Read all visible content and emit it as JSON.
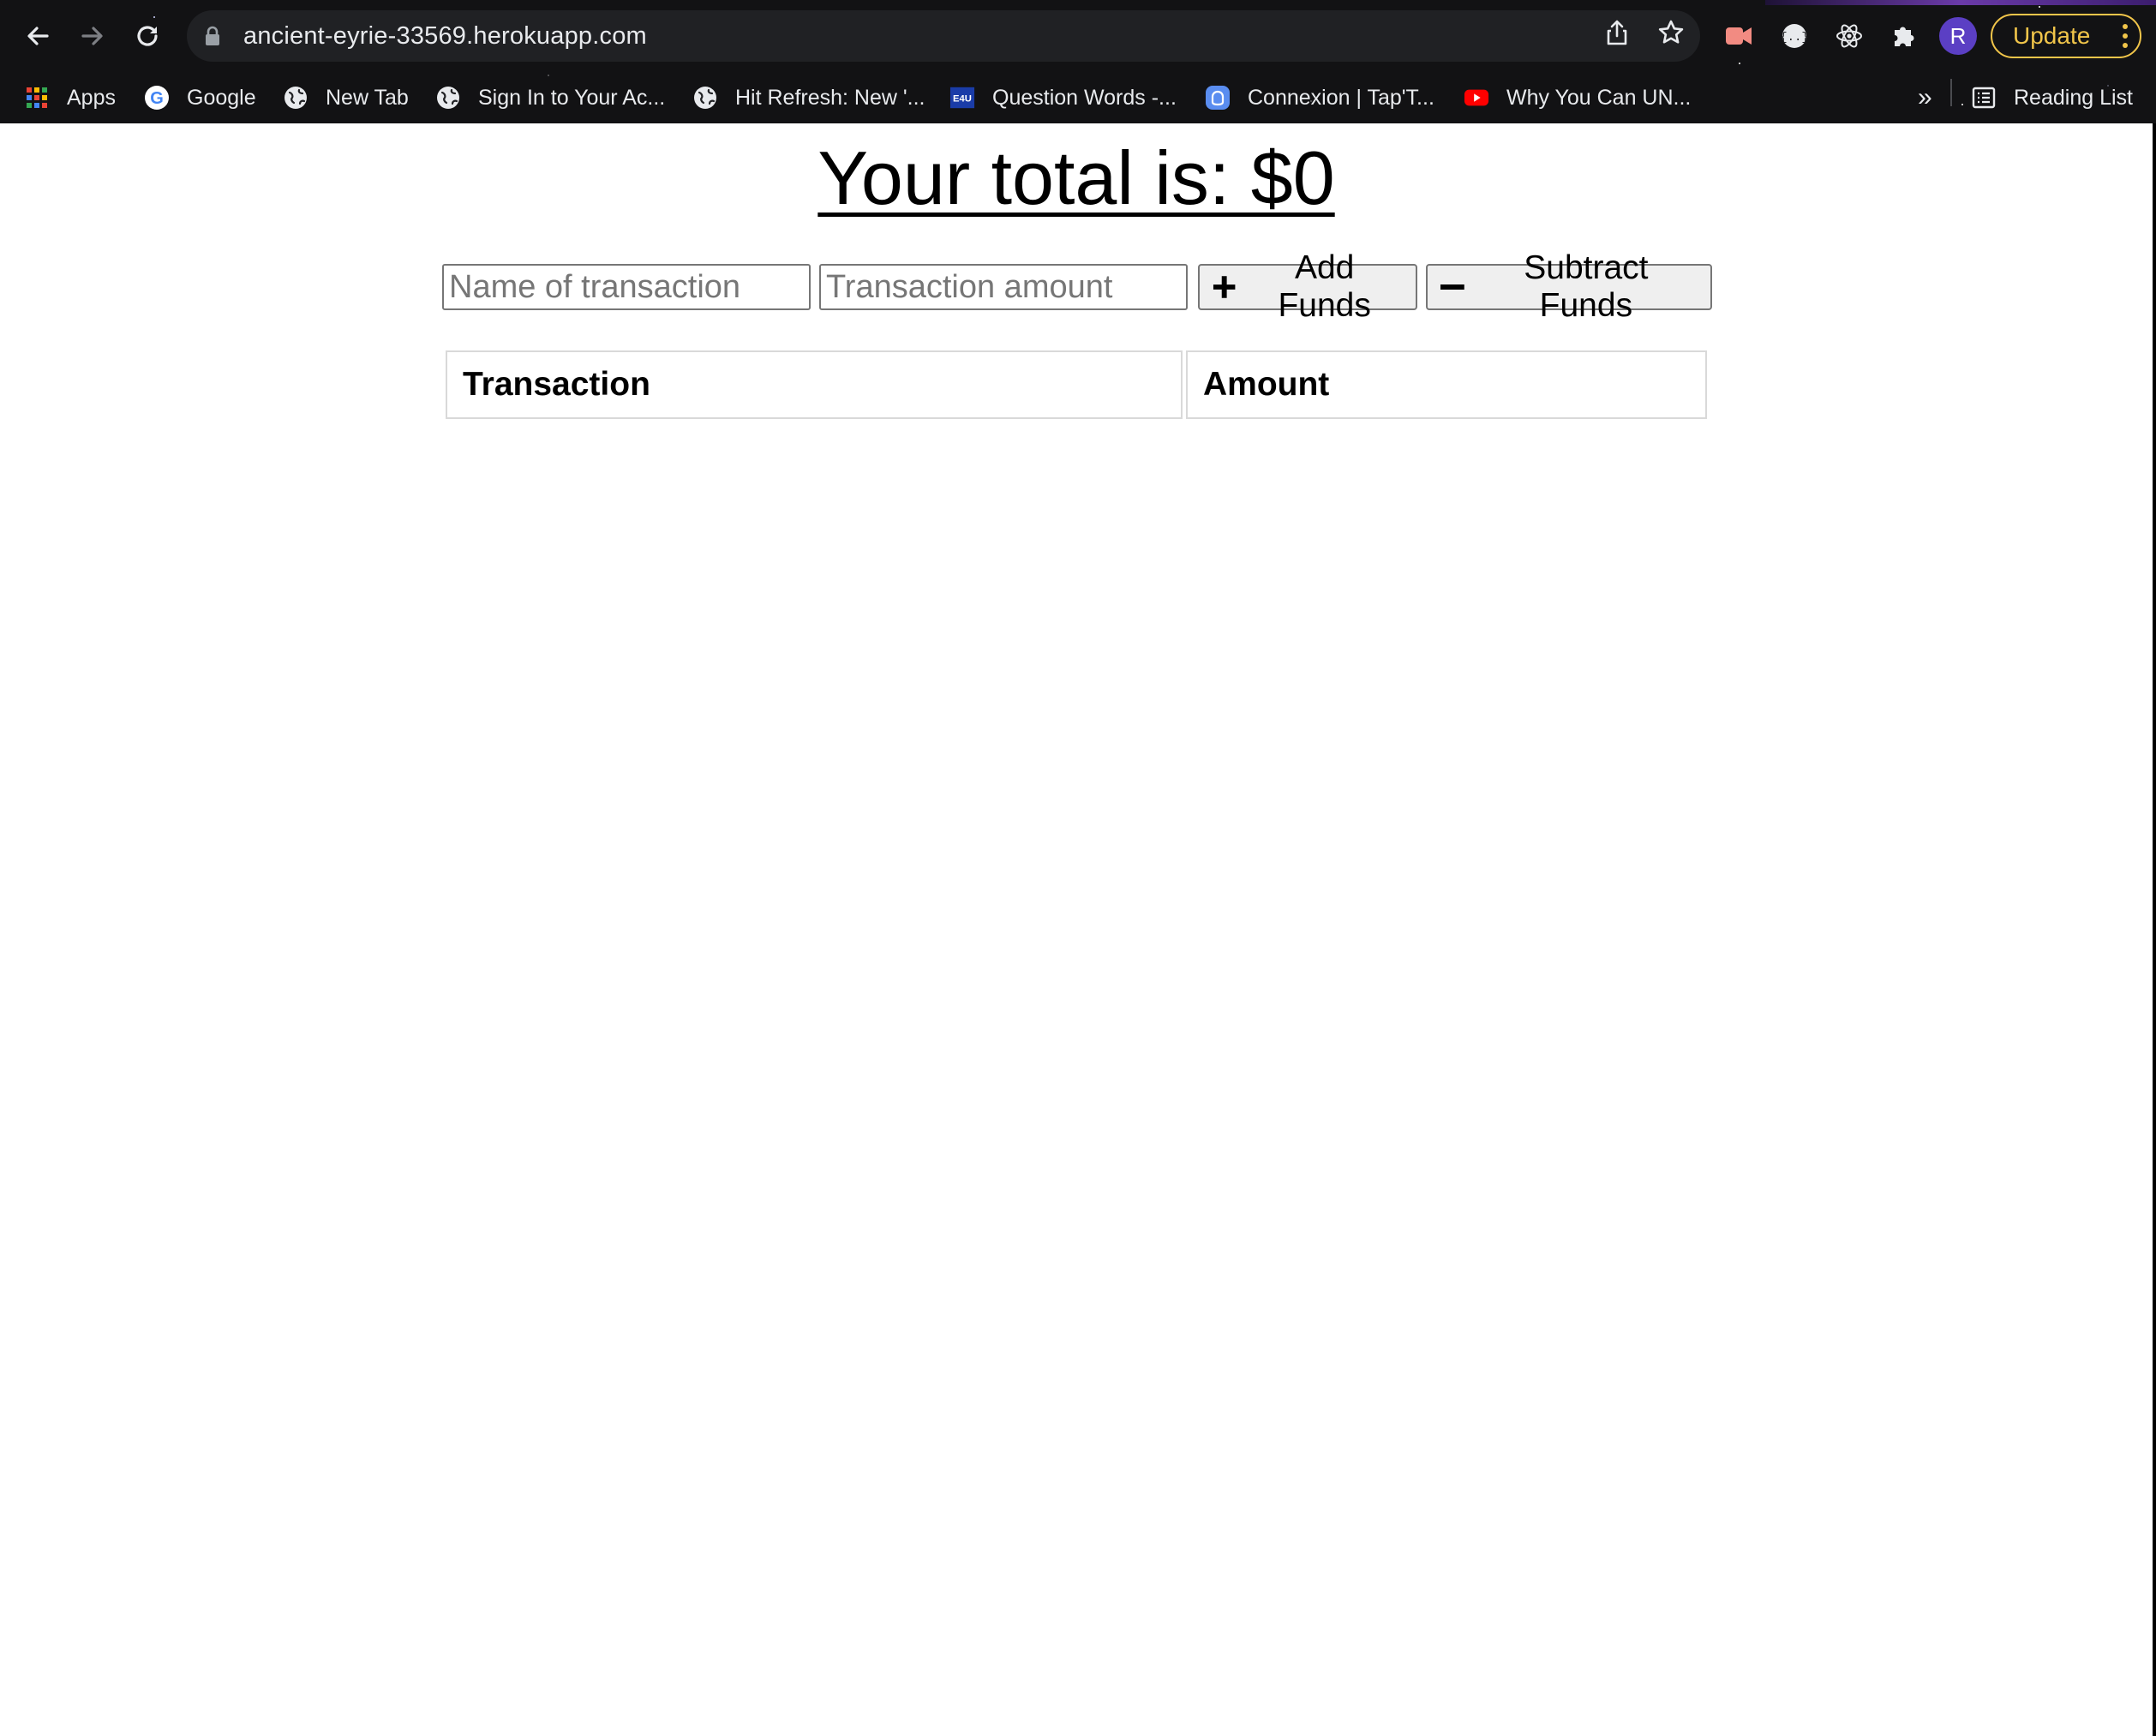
{
  "browser": {
    "url": "ancient-eyrie-33569.herokuapp.com",
    "update_label": "Update",
    "avatar_initial": "R",
    "bookmarks": [
      {
        "label": "Apps",
        "icon": "apps-grid-icon"
      },
      {
        "label": "Google",
        "icon": "google-icon"
      },
      {
        "label": "New Tab",
        "icon": "globe-icon"
      },
      {
        "label": "Sign In to Your Ac...",
        "icon": "globe-icon"
      },
      {
        "label": "Hit Refresh: New '...",
        "icon": "globe-icon"
      },
      {
        "label": "Question Words -...",
        "icon": "e4u-icon"
      },
      {
        "label": "Connexion | Tap'T...",
        "icon": "tap-icon"
      },
      {
        "label": "Why You Can UN...",
        "icon": "youtube-icon"
      }
    ],
    "overflow_label": "»",
    "reading_list_label": "Reading List"
  },
  "page": {
    "total_text": "Your total is: $0",
    "name_placeholder": "Name of transaction",
    "amount_placeholder": "Transaction amount",
    "add_label": "Add Funds",
    "subtract_label": "Subtract Funds",
    "table": {
      "headers": [
        "Transaction",
        "Amount"
      ]
    }
  },
  "colors": {
    "chrome_bg": "#121214",
    "omnibox_bg": "#202124",
    "update_accent": "#f1c54a",
    "avatar": "#5b3fc4"
  }
}
